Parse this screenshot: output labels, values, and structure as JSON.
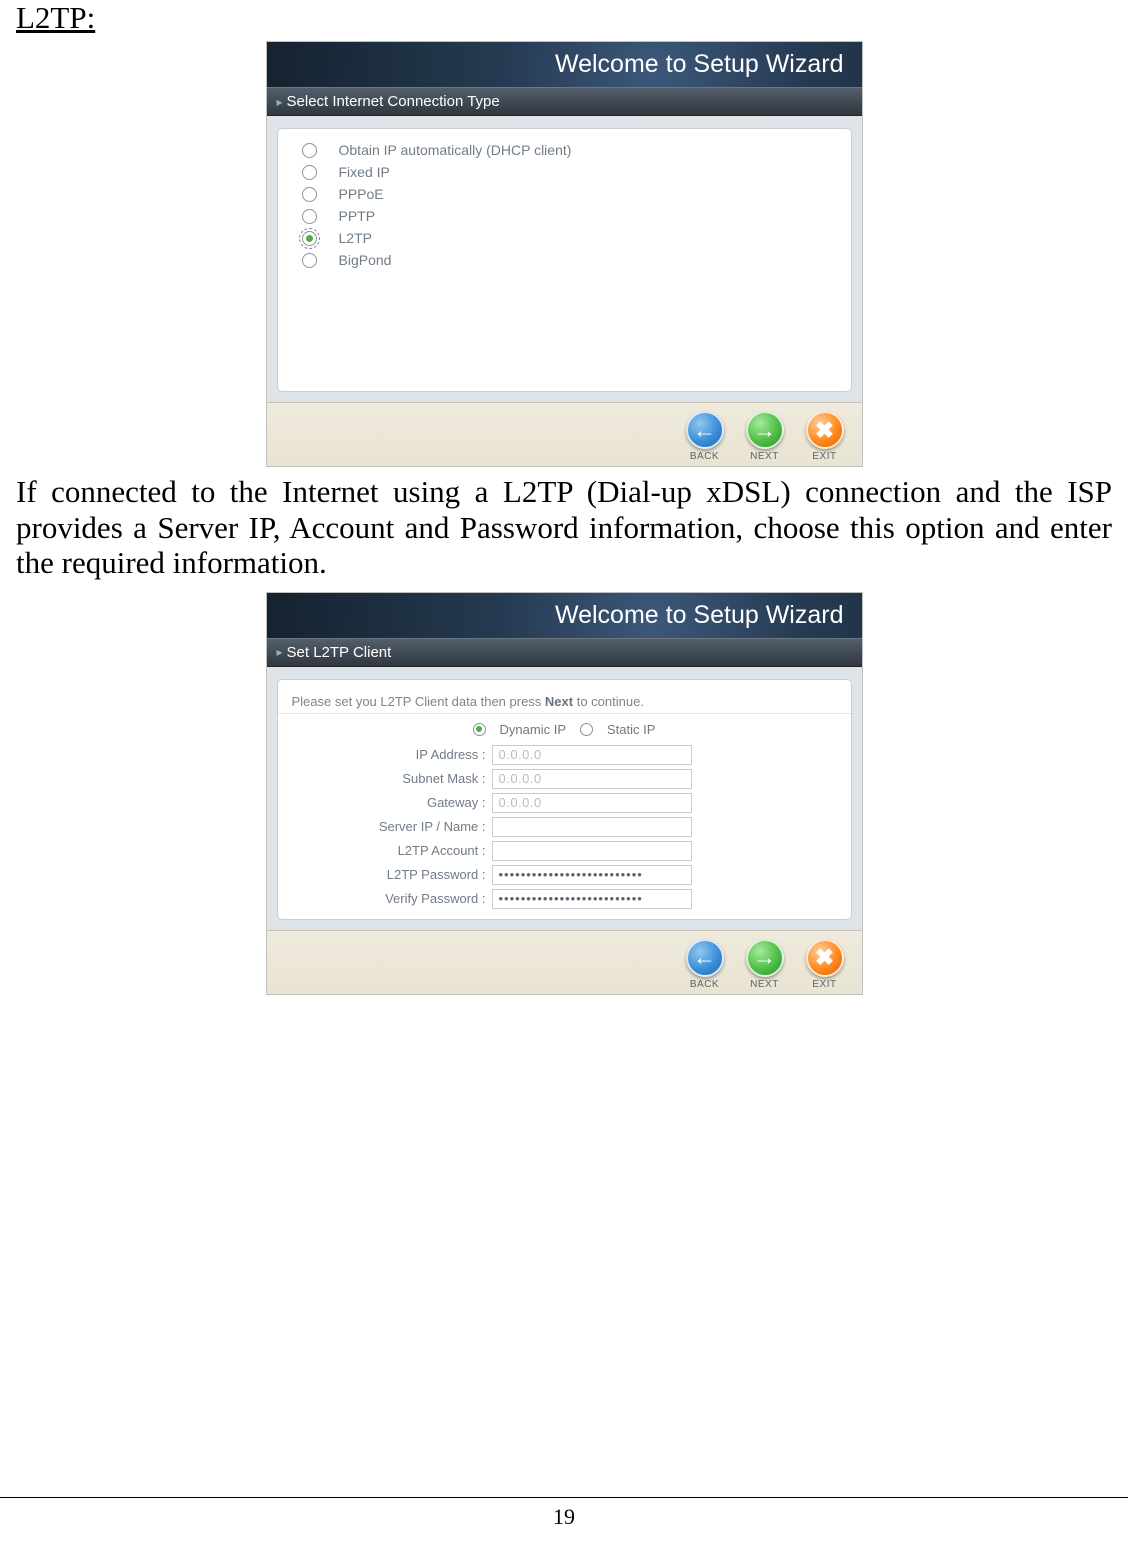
{
  "heading": "L2TP:",
  "paragraph": "If connected to the Internet using a L2TP (Dial-up xDSL) connection and the ISP provides a Server IP, Account and Password information, choose this option and enter the required information.",
  "page_number": "19",
  "wizard1": {
    "title": "Welcome to Setup Wizard",
    "section": "Select Internet Connection Type",
    "options": [
      {
        "label": "Obtain IP automatically (DHCP client)",
        "selected": false
      },
      {
        "label": "Fixed IP",
        "selected": false
      },
      {
        "label": "PPPoE",
        "selected": false
      },
      {
        "label": "PPTP",
        "selected": false
      },
      {
        "label": "L2TP",
        "selected": true
      },
      {
        "label": "BigPond",
        "selected": false
      }
    ],
    "buttons": {
      "back": "BACK",
      "next": "NEXT",
      "exit": "EXIT"
    }
  },
  "wizard2": {
    "title": "Welcome to Setup Wizard",
    "section": "Set L2TP Client",
    "hint_pre": "Please set you L2TP Client data then press ",
    "hint_bold": "Next",
    "hint_post": " to continue.",
    "ip_mode": {
      "dynamic": {
        "label": "Dynamic IP",
        "selected": true
      },
      "static": {
        "label": "Static IP",
        "selected": false
      }
    },
    "fields": {
      "ip_address": {
        "label": "IP Address :",
        "value": "0.0.0.0"
      },
      "subnet": {
        "label": "Subnet Mask :",
        "value": "0.0.0.0"
      },
      "gateway": {
        "label": "Gateway :",
        "value": "0.0.0.0"
      },
      "server": {
        "label": "Server IP / Name :",
        "value": ""
      },
      "account": {
        "label": "L2TP Account :",
        "value": ""
      },
      "password": {
        "label": "L2TP Password :",
        "value": "••••••••••••••••••••••••••"
      },
      "verify": {
        "label": "Verify Password :",
        "value": "••••••••••••••••••••••••••"
      }
    },
    "buttons": {
      "back": "BACK",
      "next": "NEXT",
      "exit": "EXIT"
    }
  }
}
